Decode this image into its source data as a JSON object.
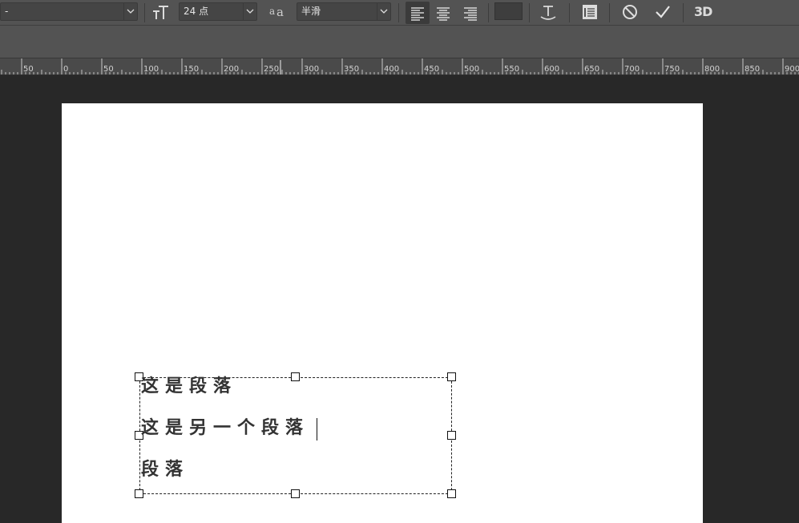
{
  "options_bar": {
    "font_style_value": "-",
    "font_size_value": "24 点",
    "antialias_value": "半滑",
    "icons": {
      "font_size": "text-size-icon",
      "antialias": "antialias-icon",
      "align_left": "align-left-icon",
      "align_center": "align-center-icon",
      "align_right": "align-right-icon",
      "warp_text": "warp-text-icon",
      "panels": "character-panel-icon",
      "cancel": "cancel-icon",
      "commit": "commit-checkmark-icon"
    },
    "color_swatch": "#3e3e3e",
    "three_d_label": "3D"
  },
  "ruler": {
    "labels": [
      "50",
      "0",
      "50",
      "100",
      "150",
      "200",
      "250",
      "300",
      "350",
      "400",
      "450",
      "500",
      "550",
      "600",
      "650",
      "700",
      "750",
      "800",
      "850",
      "900"
    ]
  },
  "document": {
    "background": "#ffffff",
    "paragraphs": [
      "这是段落",
      "这是另一个段落",
      "段落"
    ]
  }
}
